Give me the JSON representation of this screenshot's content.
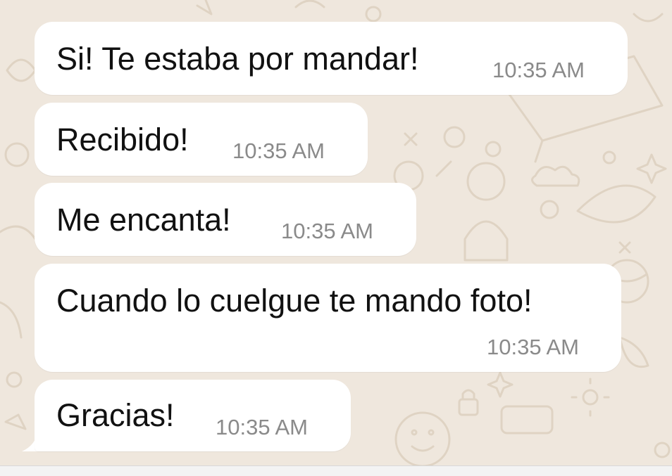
{
  "chat": {
    "messages": [
      {
        "text": "Si! Te estaba por mandar!",
        "time": "10:35 AM"
      },
      {
        "text": "Recibido!",
        "time": "10:35 AM"
      },
      {
        "text": "Me encanta!",
        "time": "10:35 AM"
      },
      {
        "text": "Cuando lo cuelgue te mando foto!",
        "time": "10:35 AM"
      },
      {
        "text": "Gracias!",
        "time": "10:35 AM"
      }
    ]
  },
  "colors": {
    "wallpaper": "#efe7dd",
    "doodle": "#dfd3c3",
    "bubble": "#ffffff",
    "text": "#111111",
    "timestamp": "#8a8a8a"
  }
}
